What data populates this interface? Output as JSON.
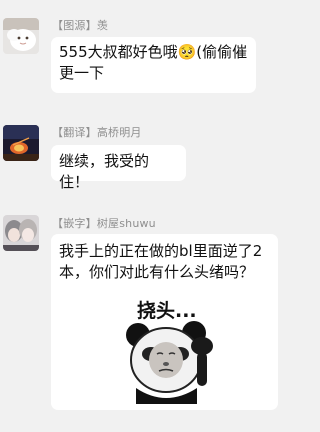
{
  "messages": [
    {
      "role": "【图源】",
      "name": "羡",
      "text": "555大叔都好色哦🥺(偷偷催更一下"
    },
    {
      "role": "【翻译】",
      "name": "高桥明月",
      "text": "继续，我受的住！"
    },
    {
      "role": "【嵌字】",
      "name": "树屋shuwu",
      "text": "我手上的正在做的bl里面逆了2本，你们对此有什么头绪吗？"
    }
  ],
  "sticker": {
    "text": "挠头..."
  },
  "colors": {
    "background": "#f1f1f1",
    "bubble": "#ffffff",
    "sender": "#8f8f8f"
  }
}
